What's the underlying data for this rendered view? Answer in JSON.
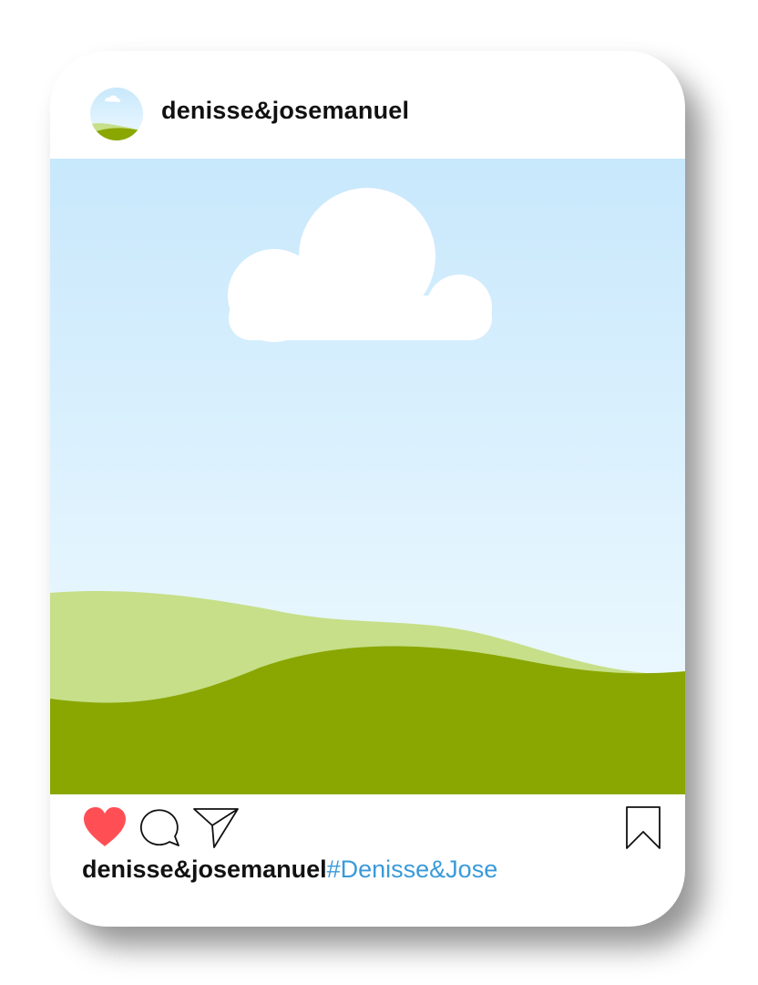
{
  "post": {
    "username": "denisse&josemanuel",
    "caption_user": "denisse&josemanuel",
    "caption_hashtag": "#Denisse&Jose"
  },
  "icons": {
    "like": "heart-icon",
    "comment": "comment-bubble-icon",
    "share": "paper-plane-icon",
    "save": "bookmark-icon"
  },
  "colors": {
    "like_red": "#ff4f55",
    "hashtag_blue": "#3a9ad9",
    "sky_top": "#c8e8fc",
    "sky_bottom": "#f0faff",
    "hill_light": "#c6df88",
    "hill_dark": "#8aa600",
    "cloud": "#ffffff"
  }
}
